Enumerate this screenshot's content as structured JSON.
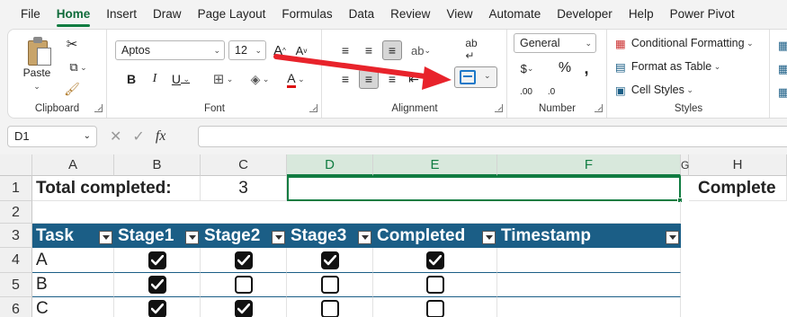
{
  "menu": [
    "File",
    "Home",
    "Insert",
    "Draw",
    "Page Layout",
    "Formulas",
    "Data",
    "Review",
    "View",
    "Automate",
    "Developer",
    "Help",
    "Power Pivot"
  ],
  "menu_active": "Home",
  "ribbon": {
    "clipboard": {
      "label": "Clipboard",
      "paste": "Paste"
    },
    "font": {
      "label": "Font",
      "family": "Aptos",
      "size": "12"
    },
    "alignment": {
      "label": "Alignment"
    },
    "number": {
      "label": "Number",
      "format": "General"
    },
    "styles": {
      "label": "Styles",
      "conditional": "Conditional Formatting",
      "table": "Format as Table",
      "cell": "Cell Styles"
    }
  },
  "namebox": "D1",
  "fx_symbol": "fx",
  "columns": [
    "A",
    "B",
    "C",
    "D",
    "E",
    "F",
    "G",
    "H"
  ],
  "rows": [
    "1",
    "2",
    "3",
    "4",
    "5",
    "6"
  ],
  "cells": {
    "a1": "Total completed:",
    "c1": "3",
    "h1": "Complete"
  },
  "table": {
    "headers": [
      "Task",
      "Stage1",
      "Stage2",
      "Stage3",
      "Completed",
      "Timestamp"
    ],
    "rows": [
      {
        "task": "A",
        "checks": [
          true,
          true,
          true,
          true
        ]
      },
      {
        "task": "B",
        "checks": [
          true,
          false,
          false,
          false
        ]
      },
      {
        "task": "C",
        "checks": [
          true,
          true,
          false,
          false
        ]
      }
    ]
  },
  "colors": {
    "accent": "#107c41",
    "table_header": "#1b5e86",
    "arrow": "#e8232b"
  }
}
